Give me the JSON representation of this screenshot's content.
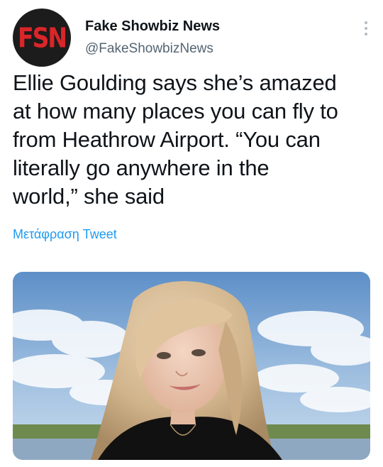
{
  "account": {
    "display_name": "Fake Showbiz News",
    "handle": "@FakeShowbizNews",
    "avatar_logo": "FSN"
  },
  "tweet": {
    "lines": [
      "Ellie Goulding says she’s amazed",
      "at how many places you can fly to",
      "from Heathrow Airport. “You can",
      "literally go anywhere in the",
      "world,” she said"
    ],
    "translate_label": "Μετάφραση Tweet"
  },
  "icons": {
    "more": "more-horizontal-icon"
  },
  "colors": {
    "link": "#1d9bf0",
    "secondary_text": "#536471",
    "avatar_bg": "#1c1c1c",
    "logo_red": "#d9262a"
  }
}
